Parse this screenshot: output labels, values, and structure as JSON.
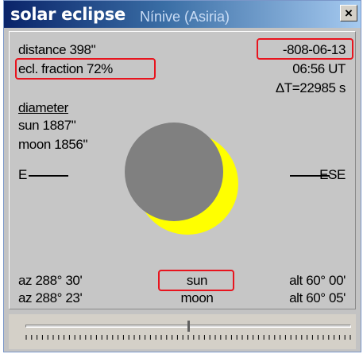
{
  "window": {
    "title": "solar eclipse",
    "location": "Nínive (Asiria)",
    "close_label": "×"
  },
  "info": {
    "distance": "distance 398\"",
    "ecl_fraction": "ecl. fraction 72%",
    "date": "-808-06-13",
    "time": "06:56 UT",
    "delta_t": "ΔT=22985 s"
  },
  "diameter": {
    "heading": "diameter",
    "sun": "sun 1887\"",
    "moon": "moon 1856\""
  },
  "directions": {
    "left": "E",
    "right": "ESE"
  },
  "positions": {
    "sun": {
      "label": "sun",
      "az": "az 288° 30'",
      "alt": "alt 60° 00'"
    },
    "moon": {
      "label": "moon",
      "az": "az 288° 23'",
      "alt": "alt 60° 05'"
    }
  },
  "slider": {
    "tick_count": 60
  },
  "colors": {
    "sun": "#ffff00",
    "moon": "#808080",
    "highlight": "#e8141e"
  }
}
